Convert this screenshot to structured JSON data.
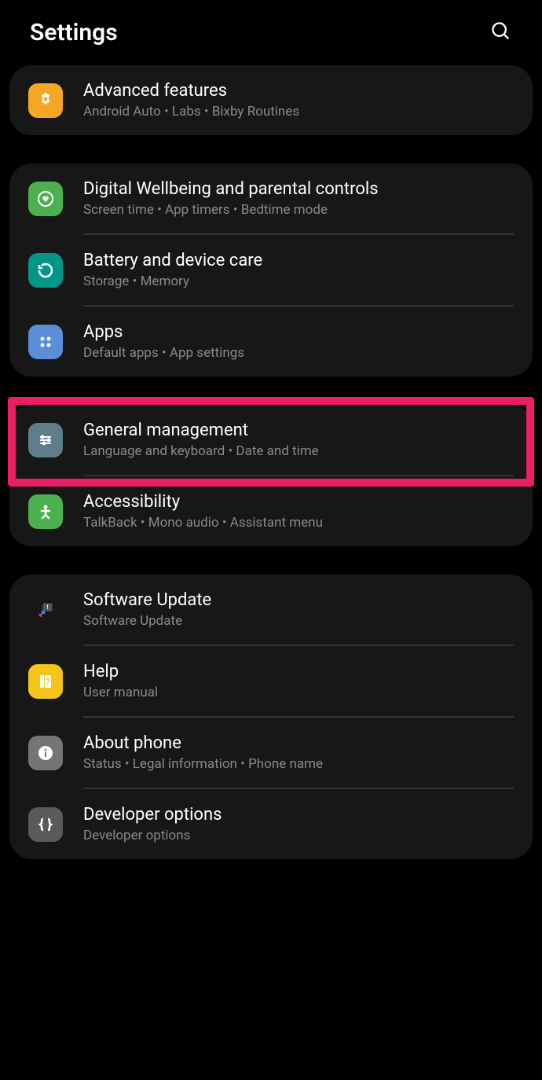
{
  "header": {
    "title": "Settings"
  },
  "groups": [
    {
      "items": [
        {
          "id": "advanced-features",
          "title": "Advanced features",
          "subtitle": "Android Auto  •  Labs  •  Bixby Routines",
          "iconColor": "#f5a623",
          "iconType": "gear-flower"
        }
      ]
    },
    {
      "items": [
        {
          "id": "digital-wellbeing",
          "title": "Digital Wellbeing and parental controls",
          "subtitle": "Screen time  •  App timers  •  Bedtime mode",
          "iconColor": "#4caf50",
          "iconType": "heart-circle"
        },
        {
          "id": "battery-device-care",
          "title": "Battery and device care",
          "subtitle": "Storage  •  Memory",
          "iconColor": "#009688",
          "iconType": "refresh-circle"
        },
        {
          "id": "apps",
          "title": "Apps",
          "subtitle": "Default apps  •  App settings",
          "iconColor": "#5b8dd8",
          "iconType": "dots-grid"
        }
      ]
    },
    {
      "items": [
        {
          "id": "general-management",
          "title": "General management",
          "subtitle": "Language and keyboard  •  Date and time",
          "iconColor": "#607d8b",
          "iconType": "sliders",
          "highlighted": true
        },
        {
          "id": "accessibility",
          "title": "Accessibility",
          "subtitle": "TalkBack  •  Mono audio  •  Assistant menu",
          "iconColor": "#4caf50",
          "iconType": "person"
        }
      ]
    },
    {
      "items": [
        {
          "id": "software-update",
          "title": "Software Update",
          "subtitle": "Software Update",
          "iconColor": "transparent",
          "iconType": "update-arrow"
        },
        {
          "id": "help",
          "title": "Help",
          "subtitle": "User manual",
          "iconColor": "#f5c518",
          "iconType": "book-question"
        },
        {
          "id": "about-phone",
          "title": "About phone",
          "subtitle": "Status  •  Legal information  •  Phone name",
          "iconColor": "#757575",
          "iconType": "info"
        },
        {
          "id": "developer-options",
          "title": "Developer options",
          "subtitle": "Developer options",
          "iconColor": "#5a5a5a",
          "iconType": "braces"
        }
      ]
    }
  ]
}
